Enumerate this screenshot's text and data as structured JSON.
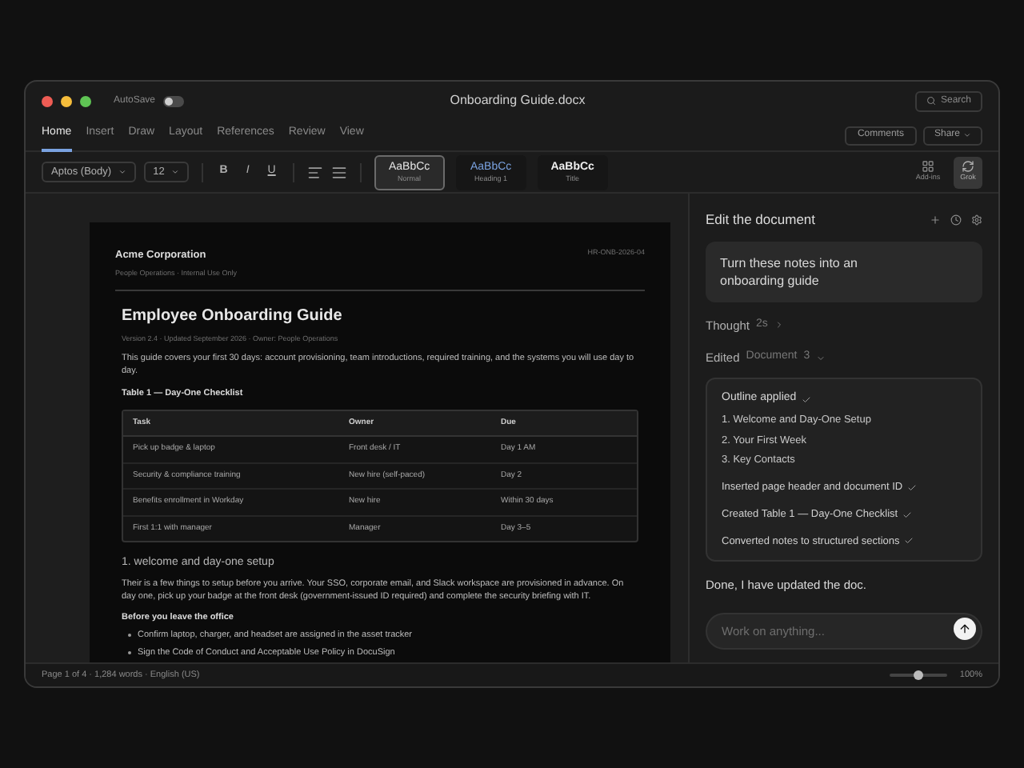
{
  "window": {
    "title": "Onboarding Guide.docx",
    "autosave_label": "AutoSave",
    "autosave_on": false,
    "search": "Search"
  },
  "ribbon_tabs": [
    {
      "label": "Home",
      "selected": true
    },
    {
      "label": "Insert",
      "selected": false
    },
    {
      "label": "Draw",
      "selected": false
    },
    {
      "label": "Layout",
      "selected": false
    },
    {
      "label": "References",
      "selected": false
    },
    {
      "label": "Review",
      "selected": false
    },
    {
      "label": "View",
      "selected": false
    }
  ],
  "ribbon_buttons": {
    "comments": "Comments",
    "share": "Share"
  },
  "toolbar": {
    "font": "Aptos (Body)",
    "size": "12",
    "format": [
      "B",
      "I",
      "U"
    ],
    "styles": [
      {
        "sample": "AaBbCc",
        "name": "Normal",
        "kind": "normal",
        "selected": true
      },
      {
        "sample": "AaBbCc",
        "name": "Heading 1",
        "kind": "heading",
        "selected": false
      },
      {
        "sample": "AaBbCc",
        "name": "Title",
        "kind": "title",
        "selected": false
      }
    ],
    "addins": "Add-ins",
    "grok": {
      "label": "Grok",
      "selected": true
    }
  },
  "document": {
    "company": "Acme Corporation",
    "department": "People Operations · Internal Use Only",
    "doc_id": "HR-ONB-2026-04",
    "title": "Employee Onboarding Guide",
    "meta": "Version 2.4 · Updated September 2026 · Owner: People Operations",
    "intro": "This guide covers your first 30 days: account provisioning, team introductions, required training, and the systems you will use day to day.",
    "table_caption": "Table 1 — Day-One Checklist",
    "table": {
      "columns": [
        "Task",
        "Owner",
        "Due"
      ],
      "rows": [
        [
          "Pick up badge & laptop",
          "Front desk / IT",
          "Day 1 AM"
        ],
        [
          "Security & compliance training",
          "New hire (self-paced)",
          "Day 2"
        ],
        [
          "Benefits enrollment in Workday",
          "New hire",
          "Within 30 days"
        ],
        [
          "First 1:1 with manager",
          "Manager",
          "Day 3–5"
        ]
      ]
    },
    "section_heading": "1. welcome and day-one setup",
    "section_body": "Their is a few things to setup before you arrive. Your SSO, corporate email, and Slack workspace are provisioned in advance. On day one, pick up your badge at the front desk (government-issued ID required) and complete the security briefing with IT.",
    "subheading": "Before you leave the office",
    "bullets": [
      "Confirm laptop, charger, and headset are assigned in the asset tracker",
      "Sign the Code of Conduct and Acceptable Use Policy in DocuSign"
    ]
  },
  "panel": {
    "title": "Edit the document",
    "prompt": "Turn these notes into an onboarding guide",
    "thought_label": "Thought",
    "thought_time": "2s",
    "edited_label": "Edited",
    "edited_target": "Document",
    "edited_count": "3",
    "outline_title": "Outline applied",
    "outline_items": [
      "1. Welcome and Day-One Setup",
      "2. Your First Week",
      "3. Key Contacts"
    ],
    "changes": [
      "Inserted page header and document ID",
      "Created Table 1 — Day-One Checklist",
      "Converted notes to structured sections"
    ],
    "reply": "Done, I have updated the doc.",
    "input_placeholder": "Work on anything..."
  },
  "status_bar": {
    "text": "Page 1 of 4 · 1,284 words · English (US)",
    "zoom": "100%",
    "level": 0.5
  }
}
